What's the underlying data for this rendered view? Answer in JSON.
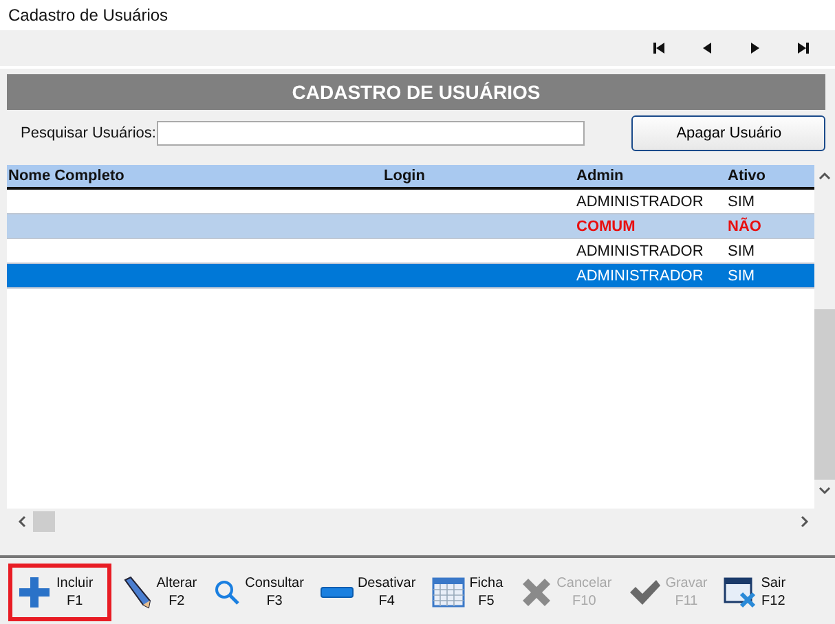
{
  "window": {
    "title": "Cadastro de Usuários"
  },
  "nav": [
    {
      "kind": "first"
    },
    {
      "kind": "prev"
    },
    {
      "kind": "next"
    },
    {
      "kind": "last"
    }
  ],
  "header": "CADASTRO DE USUÁRIOS",
  "search": {
    "label": "Pesquisar Usuários:"
  },
  "delete_button": "Apagar Usuário",
  "table": {
    "columns": [
      "Nome Completo",
      "Login",
      "Admin",
      "Ativo"
    ],
    "rows": [
      {
        "admin": "ADMINISTRADOR",
        "ativo": "SIM",
        "inactive": false,
        "selected": false
      },
      {
        "admin": "COMUM",
        "ativo": "NÃO",
        "inactive": true,
        "selected": false
      },
      {
        "admin": "ADMINISTRADOR",
        "ativo": "SIM",
        "inactive": false,
        "selected": false
      },
      {
        "admin": "ADMINISTRADOR",
        "ativo": "SIM",
        "inactive": false,
        "selected": true
      }
    ]
  },
  "toolbar": [
    {
      "kind": "plus",
      "label": "Incluir",
      "key": "F1",
      "disabled": false,
      "focused": true
    },
    {
      "kind": "pencil",
      "label": "Alterar",
      "key": "F2",
      "disabled": false,
      "focused": false
    },
    {
      "kind": "search",
      "label": "Consultar",
      "key": "F3",
      "disabled": false,
      "focused": false
    },
    {
      "kind": "minus",
      "label": "Desativar",
      "key": "F4",
      "disabled": false,
      "focused": false
    },
    {
      "kind": "sheet",
      "label": "Ficha",
      "key": "F5",
      "disabled": false,
      "focused": false
    },
    {
      "kind": "cross",
      "label": "Cancelar",
      "key": "F10",
      "disabled": true,
      "focused": false
    },
    {
      "kind": "check",
      "label": "Gravar",
      "key": "F11",
      "disabled": true,
      "focused": false
    },
    {
      "kind": "exit",
      "label": "Sair",
      "key": "F12",
      "disabled": false,
      "focused": false
    }
  ]
}
